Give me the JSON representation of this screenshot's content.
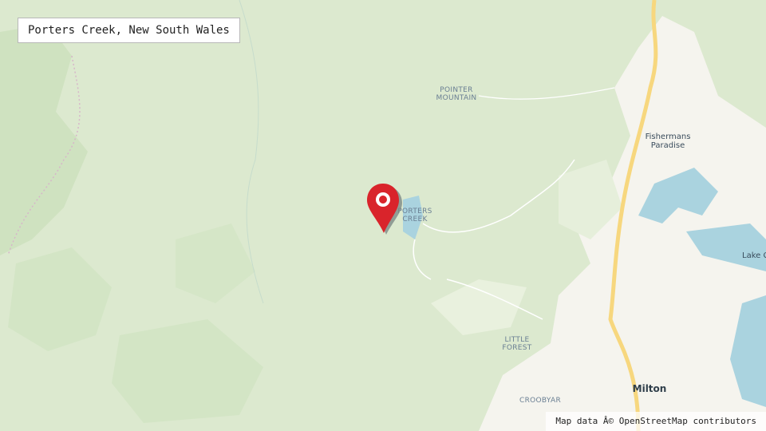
{
  "map": {
    "title": "Porters Creek, New South Wales",
    "attribution": "Map data Â© OpenStreetMap contributors",
    "marker_icon": "map-pin-icon",
    "colors": {
      "forest": "#dce9cf",
      "forest_dark": "#cfe2c0",
      "urban": "#f5f4ee",
      "water": "#aad3df",
      "highway": "#f7d77e",
      "marker": "#d9242b"
    },
    "places": {
      "pointer_mountain": "POINTER\nMOUNTAIN",
      "porters_creek": "PORTERS\nCREEK",
      "little_forest": "LITTLE\nFOREST",
      "croobyar": "CROOBYAR"
    },
    "towns": {
      "fishermans_paradise": "Fishermans\nParadise",
      "lake": "Lake C",
      "milton": "Milton"
    }
  }
}
